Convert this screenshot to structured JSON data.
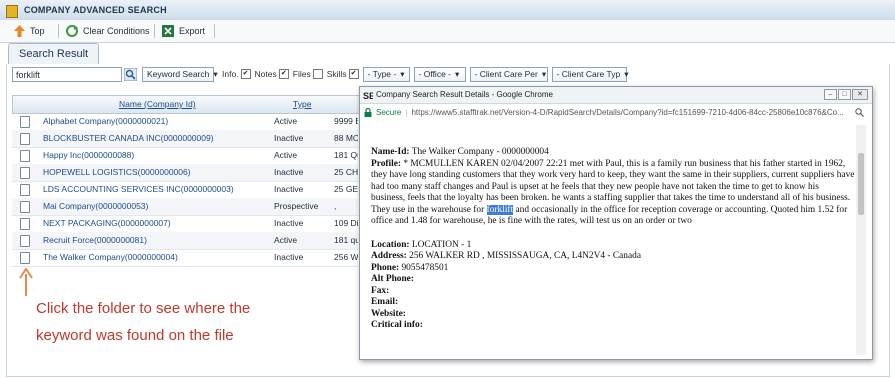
{
  "window": {
    "title": "COMPANY ADVANCED SEARCH"
  },
  "toolbar": {
    "top": "Top",
    "clear": "Clear Conditions",
    "export": "Export"
  },
  "tab": {
    "label": "Search Result"
  },
  "search": {
    "value": "forklift",
    "mode": "Keyword Search"
  },
  "filters": {
    "info": "Info.",
    "notes": "Notes",
    "files": "Files",
    "skills": "Skills",
    "type": "- Type -",
    "office": "- Office -",
    "care_per": "- Client Care Per",
    "care_typ": "- Client Care Typ"
  },
  "table": {
    "col_name": "Name (Company Id)",
    "col_type": "Type",
    "rows": [
      {
        "name": "Alphabet Company(0000000021)",
        "type": "Active",
        "extra": "9999 E"
      },
      {
        "name": "BLOCKBUSTER CANADA INC(0000000009)",
        "type": "Inactive",
        "extra": "88 MC"
      },
      {
        "name": "Happy Inc(0000000088)",
        "type": "Active",
        "extra": "181 Qu"
      },
      {
        "name": "HOPEWELL LOGISTICS(0000000006)",
        "type": "Inactive",
        "extra": "25 CH"
      },
      {
        "name": "LDS ACCOUNTING SERVICES INC(0000000003)",
        "type": "Inactive",
        "extra": "25 GE"
      },
      {
        "name": "Mai Company(0000000053)",
        "type": "Prospective",
        "extra": ","
      },
      {
        "name": "NEXT PACKAGING(0000000007)",
        "type": "Inactive",
        "extra": "109 Di"
      },
      {
        "name": "Recruit Force(0000000081)",
        "type": "Active",
        "extra": "181 qu"
      },
      {
        "name": "The Walker Company(0000000004)",
        "type": "Inactive",
        "extra": "256 W"
      }
    ]
  },
  "popup": {
    "title": "Company Search Result Details - Google Chrome",
    "secure": "Secure",
    "url": "https://www5.stafftrak.net/Version-4-D/RapidSearch/Details/Company?id=fc151699-7210-4d06-84cc-25806e10c876&Co...",
    "name_id_label": "Name-Id:",
    "name_id_value": "The Walker Company - 0000000004",
    "profile_label": "Profile:",
    "profile_before": "* MCMULLEN KAREN 02/04/2007 22:21 met with Paul, this is a family run business that his father started in 1962, they have long standing customers that they work very hard to keep, they want the same in their suppliers, current suppliers have had too many staff changes and Paul is upset at he feels that they new people have not taken the time to get to know his business, feels that the loyalty has been broken. he wants a staffing supplier that takes the time to understand all of his business. They use in the warehouse for",
    "profile_highlight": "forklift",
    "profile_after": "and occasionally in the office for reception coverage or accounting. Quoted him 1.52 for office and 1.48 for warehouse, he is fine with the rates, will test us on an order or two",
    "location_label": "Location:",
    "location_value": "LOCATION - 1",
    "address_label": "Address:",
    "address_value": "256 WALKER RD , MISSISSAUGA, CA, L4N2V4 - Canada",
    "phone_label": "Phone:",
    "phone_value": "9055478501",
    "alt_phone_label": "Alt Phone:",
    "fax_label": "Fax:",
    "email_label": "Email:",
    "website_label": "Website:",
    "critical_label": "Critical info:"
  },
  "annotation": {
    "line1": "Click the folder to see where the",
    "line2": "keyword was found on the file"
  }
}
